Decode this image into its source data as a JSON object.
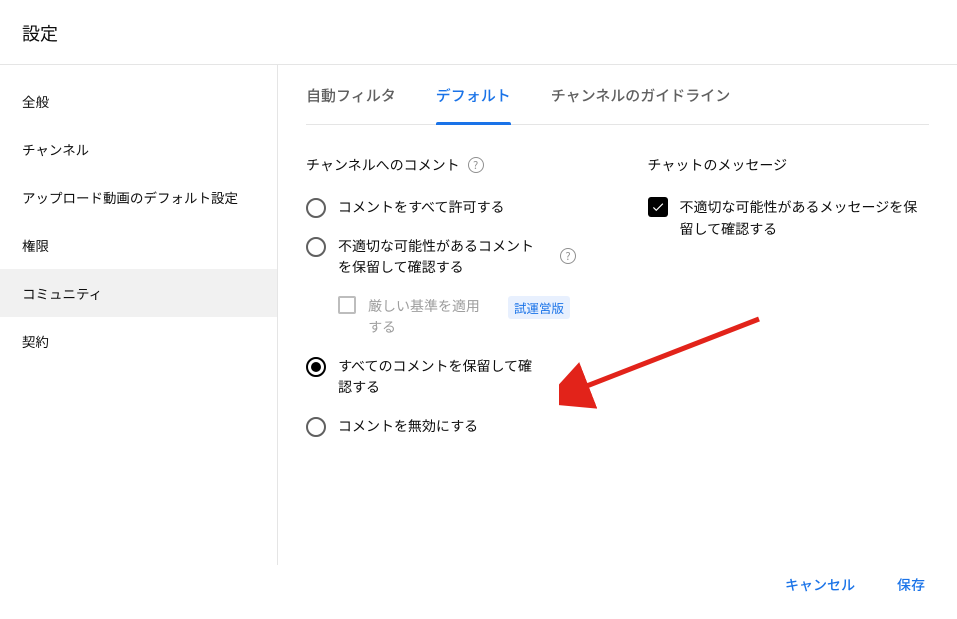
{
  "header": {
    "title": "設定"
  },
  "sidebar": {
    "items": [
      {
        "label": "全般",
        "selected": false
      },
      {
        "label": "チャンネル",
        "selected": false
      },
      {
        "label": "アップロード動画のデフォルト設定",
        "selected": false
      },
      {
        "label": "権限",
        "selected": false
      },
      {
        "label": "コミュニティ",
        "selected": true
      },
      {
        "label": "契約",
        "selected": false
      }
    ]
  },
  "tabs": {
    "items": [
      {
        "label": "自動フィルタ",
        "active": false
      },
      {
        "label": "デフォルト",
        "active": true
      },
      {
        "label": "チャンネルのガイドライン",
        "active": false
      }
    ]
  },
  "comments": {
    "section_title": "チャンネルへのコメント",
    "options": [
      {
        "label": "コメントをすべて許可する",
        "checked": false
      },
      {
        "label": "不適切な可能性があるコメントを保留して確認する",
        "checked": false,
        "has_help": true
      },
      {
        "label": "すべてのコメントを保留して確認する",
        "checked": true
      },
      {
        "label": "コメントを無効にする",
        "checked": false
      }
    ],
    "strict_sub": {
      "label": "厳しい基準を適用する",
      "badge": "試運営版"
    }
  },
  "chat": {
    "section_title": "チャットのメッセージ",
    "option": {
      "label": "不適切な可能性があるメッセージを保留して確認する",
      "checked": true
    }
  },
  "footer": {
    "cancel": "キャンセル",
    "save": "保存"
  },
  "annotation": {
    "arrow_target": "comments.options.2"
  }
}
